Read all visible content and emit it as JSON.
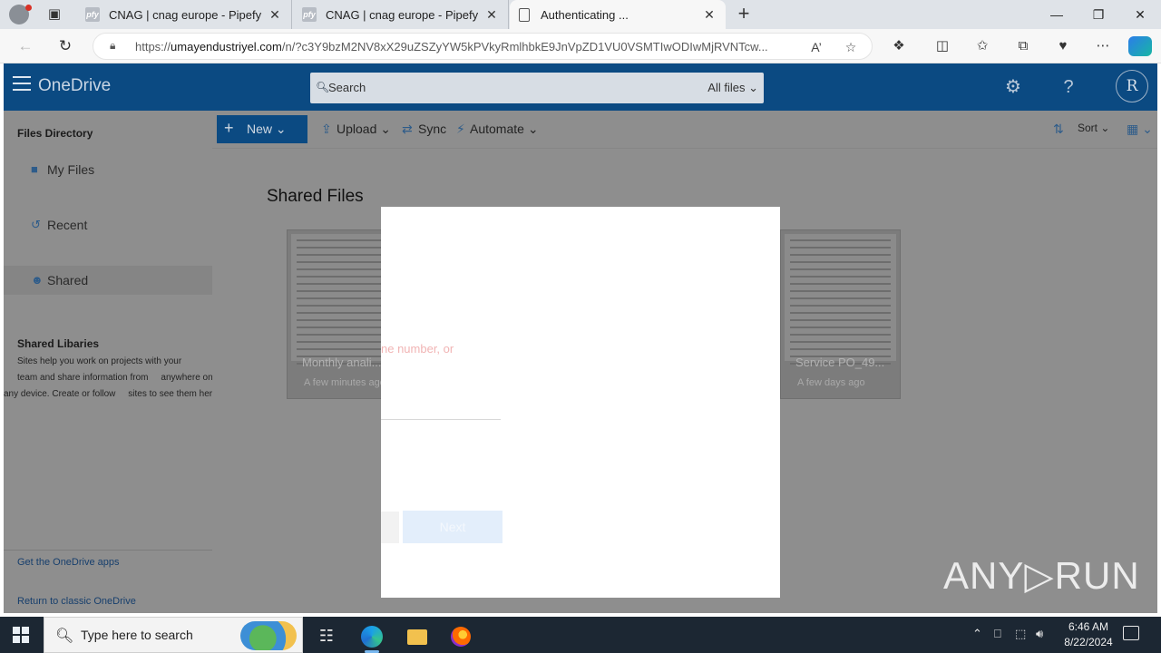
{
  "browser": {
    "tabs": [
      {
        "favicon": "pfy",
        "title": "CNAG | cnag europe - Pipefy"
      },
      {
        "favicon": "pfy",
        "title": "CNAG | cnag europe - Pipefy"
      },
      {
        "favicon": "page",
        "title": "Authenticating ..."
      }
    ],
    "url_host": "umayendustriyel.com",
    "url_prefix": "https://",
    "url_path": "/n/?c3Y9bzM2NV8xX29uZSZyYW5kPVkyRmlhbkE9JnVpZD1VU0VSMTIwODIwMjRVNTcw..."
  },
  "onedrive": {
    "brand": "OneDrive",
    "search_placeholder": "Search",
    "search_scope": "All files",
    "avatar_initial": "R",
    "left": {
      "section_title": "Files Directory",
      "items": [
        {
          "icon": "folder-icon",
          "label": "My Files"
        },
        {
          "icon": "history-icon",
          "label": "Recent"
        },
        {
          "icon": "people-icon",
          "label": "Shared"
        }
      ],
      "libraries_title": "Shared Libaries",
      "libraries_desc_1": "Sites help you work on projects with your",
      "libraries_desc_2": "team and share information from     anywhere on",
      "libraries_desc_3": "any device. Create or follow     sites to see them here.",
      "get_apps": "Get the OneDrive apps",
      "classic": "Return to classic OneDrive"
    },
    "commands": {
      "new": "New",
      "upload": "Upload",
      "sync": "Sync",
      "automate": "Automate",
      "sort": "Sort"
    },
    "section_title": "Shared Files",
    "cards": [
      {
        "name": "Monthly anali...",
        "time": "A few minutes ago"
      },
      {
        "name": "Service PO_49...",
        "time": "A few days ago"
      }
    ]
  },
  "modal": {
    "hint": "ne number, or",
    "next": "Next"
  },
  "watermark": "ANY▷RUN",
  "taskbar": {
    "search_placeholder": "Type here to search",
    "time": "6:46 AM",
    "date": "8/22/2024"
  }
}
